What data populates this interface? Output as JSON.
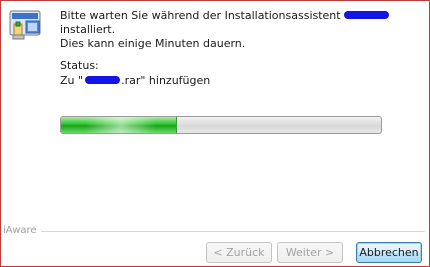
{
  "dialog": {
    "intro_line1_before": "Bitte warten Sie während der Installationsassistent",
    "intro_line1_after": "installiert.",
    "intro_line2": "Dies kann einige Minuten dauern."
  },
  "status": {
    "label": "Status:",
    "text_prefix": "Zu \"",
    "text_suffix": ".rar\" hinzufügen"
  },
  "progress": {
    "value_percent": 36
  },
  "brand": {
    "text": "iAware"
  },
  "buttons": {
    "back_label": "< Zurück",
    "next_label": "Weiter >",
    "cancel_label": "Abbrechen"
  },
  "colors": {
    "redaction": "#1414e6",
    "progress_fill": "#2fc22f",
    "frame_border": "#c23a3a"
  }
}
